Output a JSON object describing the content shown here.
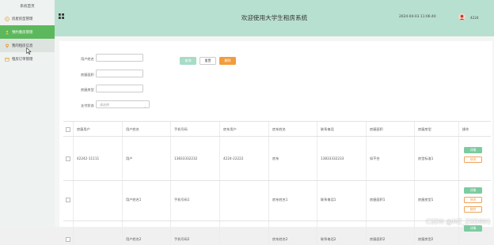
{
  "sidebar": {
    "home": "系统首页",
    "items": [
      {
        "label": "房屋房型管理",
        "icon": "coin-icon",
        "state": "normal"
      },
      {
        "label": "预约看房管理",
        "icon": "user-icon",
        "state": "active"
      },
      {
        "label": "我的租房信息",
        "icon": "pin-icon",
        "state": "hover"
      },
      {
        "label": "租房订单管理",
        "icon": "calendar-icon",
        "state": "normal"
      }
    ]
  },
  "header": {
    "title": "欢迎使用大学生租房系统",
    "datetime": "2024-04-03 11:06:40",
    "username": "4224"
  },
  "form": {
    "fields": [
      {
        "label": "用户姓名",
        "value": ""
      },
      {
        "label": "房屋面积",
        "value": ""
      },
      {
        "label": "房屋房型",
        "value": ""
      }
    ],
    "status_label": "支付状态",
    "status_placeholder": "请选择",
    "search_btn": "查询",
    "reset_btn": "重置",
    "delete_btn": "删除"
  },
  "table": {
    "headers": [
      "房屋用户",
      "用户姓名",
      "手机号码",
      "房东用户",
      "房东姓名",
      "联系电话",
      "房屋面积",
      "房屋房型",
      "操作"
    ],
    "rows": [
      [
        "42242-11111",
        "用户",
        "13833332232",
        "4224-22222",
        "房东",
        "13833332233",
        "如不合",
        "房型标准1"
      ],
      [
        "",
        "用户姓名1",
        "手机号码1",
        "",
        "房东姓名1",
        "联系电话1",
        "房屋面积1",
        "房屋房型1"
      ],
      [
        "",
        "用户姓名2",
        "手机号码2",
        "",
        "房东姓名2",
        "联系电话2",
        "房屋面积2",
        "房屋房型2"
      ]
    ],
    "actions": {
      "detail": "详情",
      "edit": "修改",
      "delete": "删除"
    }
  },
  "colors": {
    "header_bg": "#b8e0d0",
    "active_green": "#5cb85c",
    "search_btn": "#a7dcc6",
    "delete_btn": "#f39c3c"
  },
  "watermark": "CSDN @MZ_ZXD001"
}
